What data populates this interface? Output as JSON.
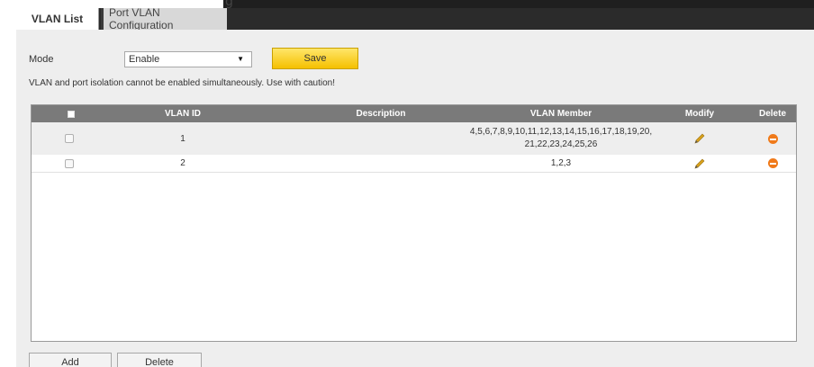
{
  "top": {
    "clipped_text": "g"
  },
  "tabs": [
    {
      "label": "VLAN List",
      "active": true
    },
    {
      "label": "Port VLAN Configuration",
      "active": false
    }
  ],
  "mode": {
    "label": "Mode",
    "value": "Enable",
    "save_label": "Save"
  },
  "warning": "VLAN and port isolation cannot be enabled simultaneously. Use with caution!",
  "table": {
    "columns": [
      "VLAN ID",
      "Description",
      "VLAN Member",
      "Modify",
      "Delete"
    ],
    "rows": [
      {
        "vlan_id": "1",
        "description": "",
        "member_line1": "4,5,6,7,8,9,10,11,12,13,14,15,16,17,18,19,20,",
        "member_line2": "21,22,23,24,25,26"
      },
      {
        "vlan_id": "2",
        "description": "",
        "member_line1": "1,2,3",
        "member_line2": ""
      }
    ]
  },
  "actions": {
    "add_label": "Add",
    "delete_label": "Delete"
  },
  "colors": {
    "save_button": "#f5c000",
    "table_header": "#7a7a7a",
    "delete_icon": "#f07a1a",
    "edit_icon": "#d9a21b"
  }
}
